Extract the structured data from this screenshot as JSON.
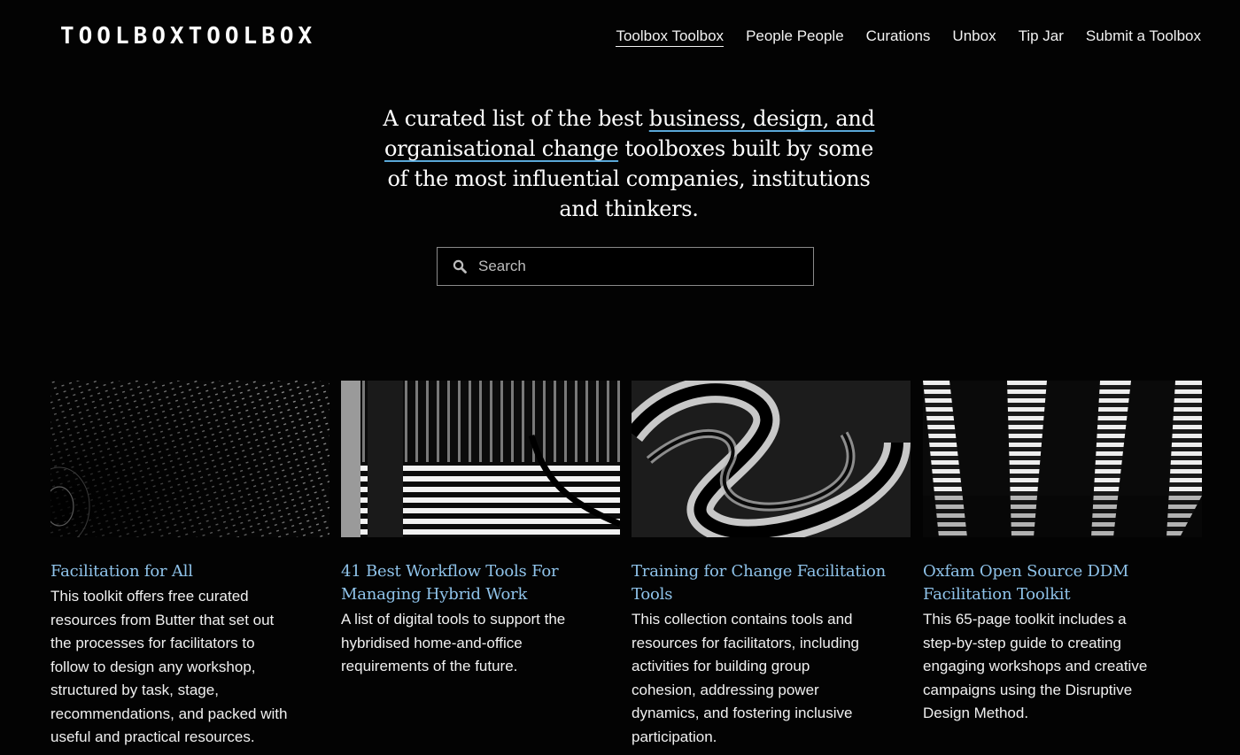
{
  "header": {
    "logo": "TOOLBOXTOOLBOX",
    "nav": [
      {
        "label": "Toolbox Toolbox",
        "active": true
      },
      {
        "label": "People People"
      },
      {
        "label": "Curations"
      },
      {
        "label": "Unbox"
      },
      {
        "label": "Tip Jar"
      },
      {
        "label": "Submit a Toolbox"
      }
    ]
  },
  "hero": {
    "text_before": "A curated list of the best ",
    "highlight": "business, design, and organisational change",
    "text_after": " toolboxes built by some of the most influential companies, institutions and thinkers."
  },
  "search": {
    "placeholder": "Search",
    "value": ""
  },
  "colors": {
    "background": "#030303",
    "link": "#8fc3ea",
    "underline_accent": "#5aa8d8"
  },
  "cards": [
    {
      "title": "Facilitation for All",
      "description": "This toolkit offers free curated resources from Butter that set out the processes for facilitators to follow to design any workshop, structured by task, stage, recommendations, and packed with useful and practical resources.",
      "image": "dotted-tunnel-image"
    },
    {
      "title": "41 Best Workflow Tools For Managing Hybrid Work",
      "description": "A list of digital tools to support the hybridised home-and-office requirements of the future.",
      "image": "striped-corridor-image"
    },
    {
      "title": "Training for Change Facilitation Tools",
      "description": "This collection contains tools and resources for facilitators, including activities for building group cohesion, addressing power dynamics, and fostering inclusive participation.",
      "image": "swirl-image"
    },
    {
      "title": "Oxfam Open Source DDM Facilitation Toolkit",
      "description": "This 65-page toolkit includes a step-by-step guide to creating engaging workshops and creative campaigns using the Disruptive Design Method.",
      "image": "light-beams-image"
    }
  ]
}
